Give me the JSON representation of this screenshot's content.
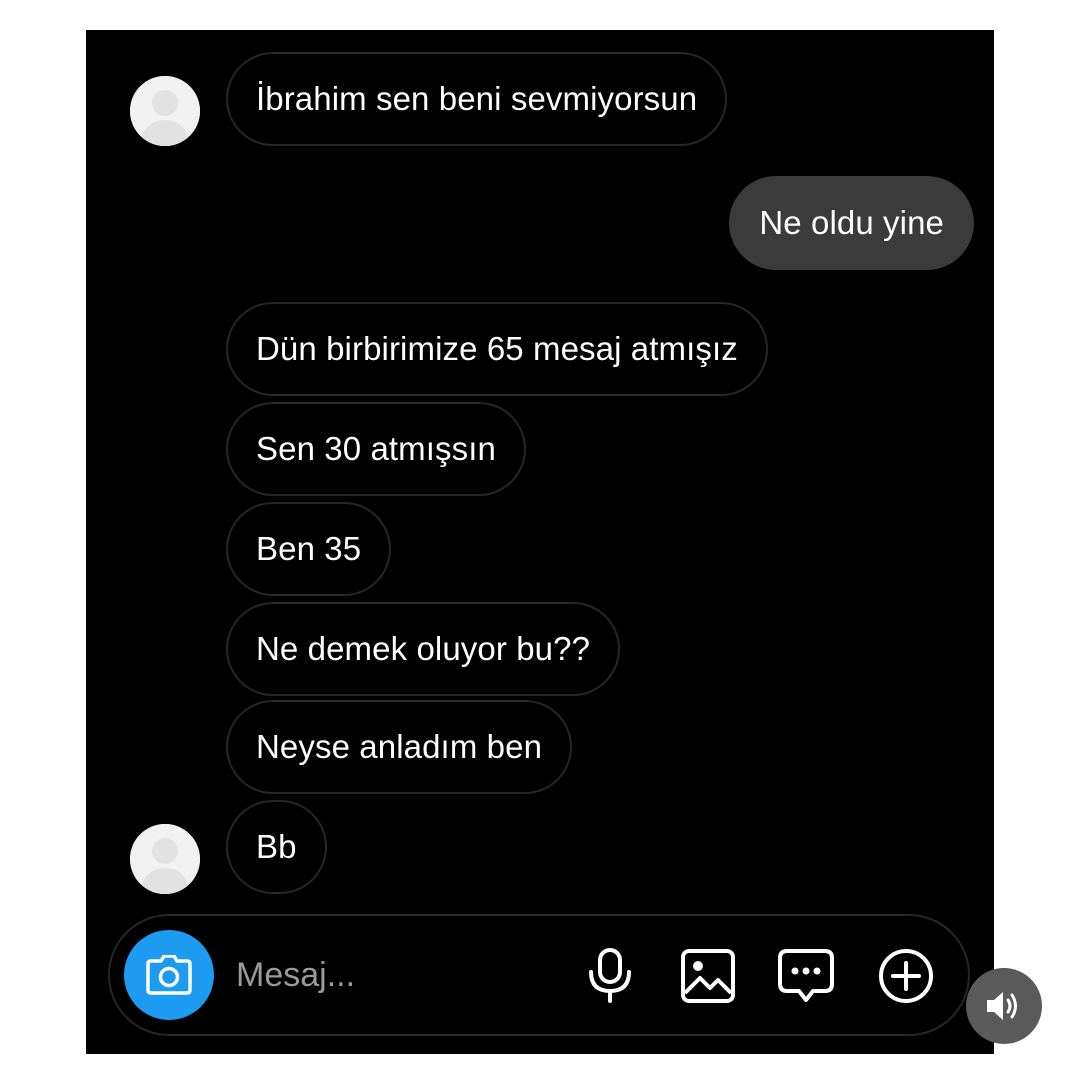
{
  "chat": {
    "messages": [
      {
        "sender": "other",
        "text": "İbrahim sen beni sevmiyorsun"
      },
      {
        "sender": "me",
        "text": "Ne oldu yine"
      },
      {
        "sender": "other",
        "text": "Dün birbirimize 65 mesaj atmışız"
      },
      {
        "sender": "other",
        "text": "Sen 30 atmışsın"
      },
      {
        "sender": "other",
        "text": "Ben 35"
      },
      {
        "sender": "other",
        "text": "Ne demek oluyor bu??"
      },
      {
        "sender": "other",
        "text": "Neyse anladım ben"
      },
      {
        "sender": "other",
        "text": "Bb"
      }
    ]
  },
  "composer": {
    "placeholder": "Mesaj...",
    "icons": [
      "camera-icon",
      "microphone-icon",
      "gallery-icon",
      "sticker-icon",
      "add-icon"
    ],
    "camera_color": "#1d9bf0"
  },
  "overlay": {
    "icon": "speaker-icon"
  },
  "colors": {
    "background": "#000000",
    "sent_bubble": "#3b3b3b",
    "received_border": "#262626",
    "text": "#ffffff"
  }
}
